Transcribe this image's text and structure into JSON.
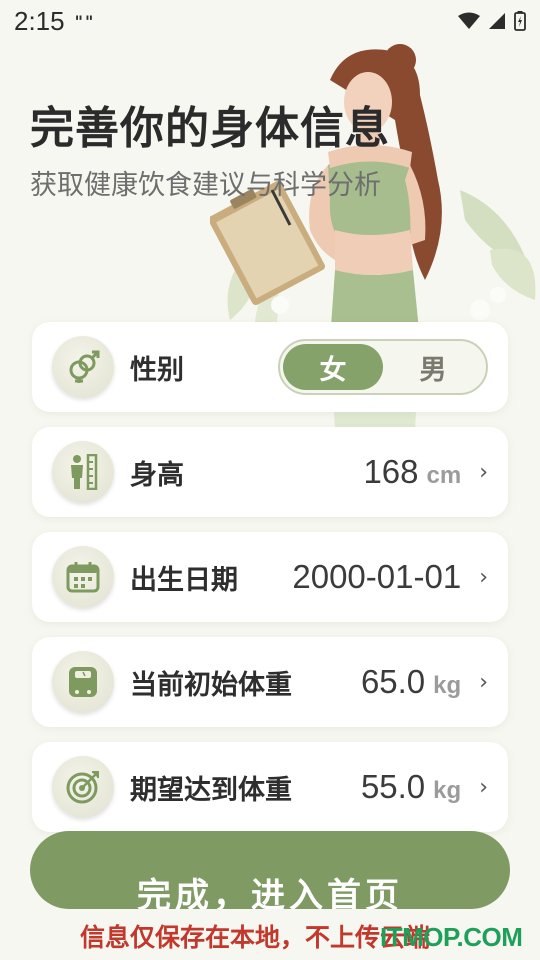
{
  "status_bar": {
    "time": "2:15",
    "notification": "\"\""
  },
  "header": {
    "title": "完善你的身体信息",
    "subtitle": "获取健康饮食建议与科学分析"
  },
  "form": {
    "gender": {
      "label": "性别",
      "options": [
        "女",
        "男"
      ],
      "selected": "女"
    },
    "height": {
      "label": "身高",
      "value": "168",
      "unit": "cm"
    },
    "birthday": {
      "label": "出生日期",
      "value": "2000-01-01"
    },
    "current_weight": {
      "label": "当前初始体重",
      "value": "65.0",
      "unit": "kg"
    },
    "target_weight": {
      "label": "期望达到体重",
      "value": "55.0",
      "unit": "kg"
    }
  },
  "cta": {
    "label": "完成，进入首页"
  },
  "footer_note": "信息仅保存在本地，不上传云端",
  "watermark": "ITMOP.COM",
  "colors": {
    "accent": "#86a26b",
    "button": "#7f9a63",
    "note": "#c2382c"
  }
}
